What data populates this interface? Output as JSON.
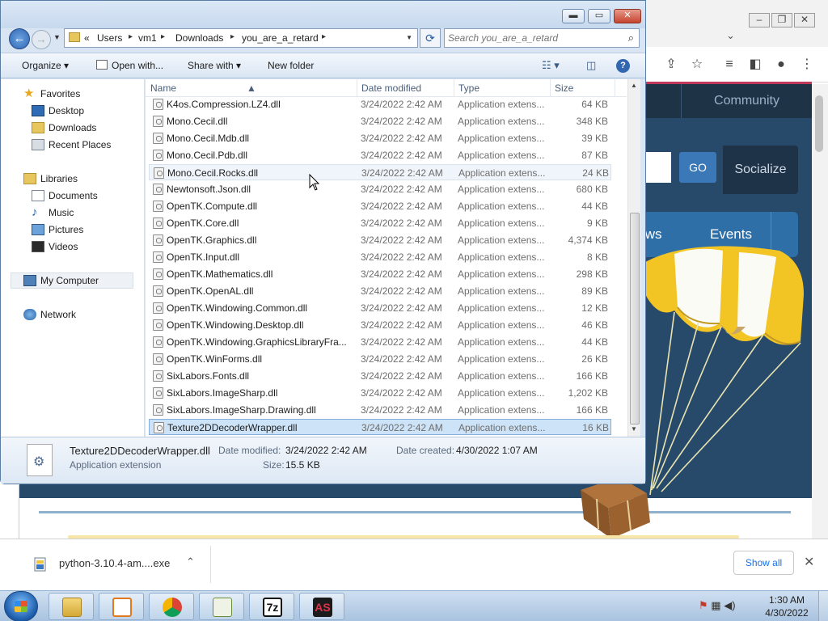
{
  "explorer": {
    "breadcrumbs": [
      "Users",
      "vm1",
      "Downloads",
      "you_are_a_retard"
    ],
    "crumb_prefix": "«",
    "search_placeholder": "Search you_are_a_retard",
    "toolbar": {
      "organize": "Organize",
      "open_with": "Open with...",
      "share_with": "Share with",
      "new_folder": "New folder"
    },
    "nav": {
      "favorites": "Favorites",
      "desktop": "Desktop",
      "downloads": "Downloads",
      "recent_places": "Recent Places",
      "libraries": "Libraries",
      "documents": "Documents",
      "music": "Music",
      "pictures": "Pictures",
      "videos": "Videos",
      "my_computer": "My Computer",
      "network": "Network"
    },
    "columns": {
      "name": "Name",
      "date": "Date modified",
      "type": "Type",
      "size": "Size"
    },
    "files": [
      {
        "name": "K4os.Compression.LZ4.dll",
        "date": "3/24/2022 2:42 AM",
        "type": "Application extens...",
        "size": "64 KB"
      },
      {
        "name": "Mono.Cecil.dll",
        "date": "3/24/2022 2:42 AM",
        "type": "Application extens...",
        "size": "348 KB"
      },
      {
        "name": "Mono.Cecil.Mdb.dll",
        "date": "3/24/2022 2:42 AM",
        "type": "Application extens...",
        "size": "39 KB"
      },
      {
        "name": "Mono.Cecil.Pdb.dll",
        "date": "3/24/2022 2:42 AM",
        "type": "Application extens...",
        "size": "87 KB"
      },
      {
        "name": "Mono.Cecil.Rocks.dll",
        "date": "3/24/2022 2:42 AM",
        "type": "Application extens...",
        "size": "24 KB"
      },
      {
        "name": "Newtonsoft.Json.dll",
        "date": "3/24/2022 2:42 AM",
        "type": "Application extens...",
        "size": "680 KB"
      },
      {
        "name": "OpenTK.Compute.dll",
        "date": "3/24/2022 2:42 AM",
        "type": "Application extens...",
        "size": "44 KB"
      },
      {
        "name": "OpenTK.Core.dll",
        "date": "3/24/2022 2:42 AM",
        "type": "Application extens...",
        "size": "9 KB"
      },
      {
        "name": "OpenTK.Graphics.dll",
        "date": "3/24/2022 2:42 AM",
        "type": "Application extens...",
        "size": "4,374 KB"
      },
      {
        "name": "OpenTK.Input.dll",
        "date": "3/24/2022 2:42 AM",
        "type": "Application extens...",
        "size": "8 KB"
      },
      {
        "name": "OpenTK.Mathematics.dll",
        "date": "3/24/2022 2:42 AM",
        "type": "Application extens...",
        "size": "298 KB"
      },
      {
        "name": "OpenTK.OpenAL.dll",
        "date": "3/24/2022 2:42 AM",
        "type": "Application extens...",
        "size": "89 KB"
      },
      {
        "name": "OpenTK.Windowing.Common.dll",
        "date": "3/24/2022 2:42 AM",
        "type": "Application extens...",
        "size": "12 KB"
      },
      {
        "name": "OpenTK.Windowing.Desktop.dll",
        "date": "3/24/2022 2:42 AM",
        "type": "Application extens...",
        "size": "46 KB"
      },
      {
        "name": "OpenTK.Windowing.GraphicsLibraryFra...",
        "date": "3/24/2022 2:42 AM",
        "type": "Application extens...",
        "size": "44 KB"
      },
      {
        "name": "OpenTK.WinForms.dll",
        "date": "3/24/2022 2:42 AM",
        "type": "Application extens...",
        "size": "26 KB"
      },
      {
        "name": "SixLabors.Fonts.dll",
        "date": "3/24/2022 2:42 AM",
        "type": "Application extens...",
        "size": "166 KB"
      },
      {
        "name": "SixLabors.ImageSharp.dll",
        "date": "3/24/2022 2:42 AM",
        "type": "Application extens...",
        "size": "1,202 KB"
      },
      {
        "name": "SixLabors.ImageSharp.Drawing.dll",
        "date": "3/24/2022 2:42 AM",
        "type": "Application extens...",
        "size": "166 KB"
      },
      {
        "name": "Texture2DDecoderWrapper.dll",
        "date": "3/24/2022 2:42 AM",
        "type": "Application extens...",
        "size": "16 KB"
      }
    ],
    "hover_index": 4,
    "selected_index": 19,
    "details": {
      "name": "Texture2DDecoderWrapper.dll",
      "type": "Application extension",
      "modified_label": "Date modified:",
      "modified": "3/24/2022 2:42 AM",
      "created_label": "Date created:",
      "created": "4/30/2022 1:07 AM",
      "size_label": "Size:",
      "size": "15.5 KB"
    }
  },
  "browser": {
    "nav_community": "Community",
    "go": "GO",
    "socialize": "Socialize",
    "nav_news": "News",
    "nav_events": "Events",
    "download_file": "python-3.10.4-am....exe",
    "show_all": "Show all"
  },
  "taskbar": {
    "time": "1:30 AM",
    "date": "4/30/2022",
    "apps": [
      "explorer-icon",
      "media-player-icon",
      "chrome-icon",
      "notepad-plus-icon",
      "7zip-icon",
      "assetstudio-icon"
    ],
    "app_7z": "7z",
    "app_as": "AS"
  },
  "colors": {
    "site_bg": "#274a6b",
    "accent_blue": "#2e6fa8",
    "selection": "#cde3f7"
  }
}
